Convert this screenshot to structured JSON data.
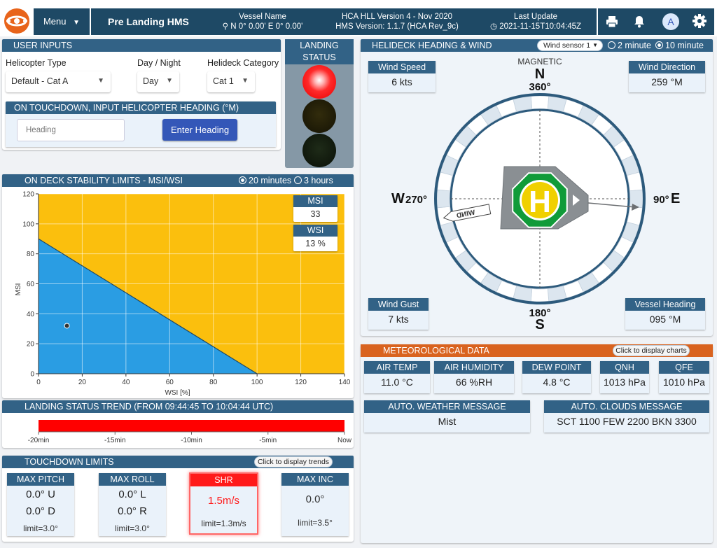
{
  "header": {
    "menu_label": "Menu",
    "page_title": "Pre Landing HMS",
    "vessel_name_label": "Vessel Name",
    "vessel_position": "N 0° 0.00'  E 0° 0.00'",
    "version_line1": "HCA HLL Version 4 - Nov 2020",
    "version_line2": "HMS Version: 1.1.7 (HCA Rev_9c)",
    "last_update_label": "Last Update",
    "last_update_value": "2021-11-15T10:04:45Z",
    "avatar_letter": "A"
  },
  "user_inputs": {
    "title": "USER INPUTS",
    "helicopter_type_label": "Helicopter Type",
    "helicopter_type_value": "Default - Cat A",
    "day_night_label": "Day / Night",
    "day_night_value": "Day",
    "helideck_category_label": "Helideck Category",
    "helideck_category_value": "Cat 1",
    "touchdown_title": "ON TOUCHDOWN, INPUT HELICOPTER HEADING (°M)",
    "heading_placeholder": "Heading",
    "enter_heading_label": "Enter Heading"
  },
  "landing_status": {
    "title_line1": "LANDING",
    "title_line2": "STATUS",
    "state": "red"
  },
  "stability": {
    "title": "ON DECK STABILITY LIMITS - MSI/WSI",
    "option_20min": "20 minutes",
    "option_3h": "3 hours",
    "selected": "20 minutes",
    "msi_label": "MSI",
    "msi_value": "33",
    "wsi_label": "WSI",
    "wsi_value": "13 %"
  },
  "chart_data": {
    "type": "area",
    "xlabel": "WSI [%]",
    "ylabel": "MSI",
    "xlim": [
      0,
      140
    ],
    "ylim": [
      0,
      120
    ],
    "x_ticks": [
      0,
      20,
      40,
      60,
      80,
      100,
      120,
      140
    ],
    "y_ticks": [
      0,
      20,
      40,
      60,
      80,
      100,
      120
    ],
    "limit_line": {
      "x": [
        0,
        100
      ],
      "y": [
        90,
        0
      ]
    },
    "region_below_color": "#2a9de3",
    "region_above_color": "#fbbf0d",
    "current_point": {
      "x": 13,
      "y": 32
    },
    "grid": true
  },
  "trend": {
    "title": "LANDING STATUS TREND (FROM 09:44:45 TO 10:04:44 UTC)",
    "tick_labels": [
      "-20min",
      "-15min",
      "-10min",
      "-5min",
      "Now"
    ],
    "bar_color": "#ff0000"
  },
  "touchdown_limits": {
    "title": "TOUCHDOWN LIMITS",
    "trends_button": "Click to display trends",
    "max_pitch": {
      "label": "MAX PITCH",
      "line1": "0.0° U",
      "line2": "0.0° D",
      "limit": "limit=3.0°"
    },
    "max_roll": {
      "label": "MAX ROLL",
      "line1": "0.0° L",
      "line2": "0.0° R",
      "limit": "limit=3.0°"
    },
    "shr": {
      "label": "SHR",
      "value": "1.5m/s",
      "limit": "limit=1.3m/s"
    },
    "max_inc": {
      "label": "MAX INC",
      "value": "0.0°",
      "limit": "limit=3.5°"
    }
  },
  "helideck": {
    "title": "HELIDECK HEADING & WIND",
    "sensor_value": "Wind sensor 1",
    "option_2min": "2 minute",
    "option_10min": "10 minute",
    "selected": "10 minute",
    "magnetic_label": "MAGNETIC",
    "n_letter": "N",
    "n_deg": "360°",
    "s_letter": "S",
    "s_deg": "180°",
    "w_letter": "W",
    "w_deg": "270°",
    "e_letter": "E",
    "e_deg": "90°",
    "wind_arrow_label": "WIND",
    "helipad_letter": "H",
    "wind_speed": {
      "label": "Wind Speed",
      "value": "6 kts"
    },
    "wind_direction": {
      "label": "Wind Direction",
      "value": "259 °M"
    },
    "wind_gust": {
      "label": "Wind Gust",
      "value": "7 kts"
    },
    "vessel_heading": {
      "label": "Vessel Heading",
      "value": "095 °M"
    }
  },
  "meteo": {
    "title": "METEOROLOGICAL DATA",
    "charts_button": "Click to display charts",
    "air_temp": {
      "label": "AIR TEMP",
      "value": "11.0 °C"
    },
    "air_humidity": {
      "label": "AIR HUMIDITY",
      "value": "66 %RH"
    },
    "dew_point": {
      "label": "DEW POINT",
      "value": "4.8 °C"
    },
    "qnh": {
      "label": "QNH",
      "value": "1013 hPa"
    },
    "qfe": {
      "label": "QFE",
      "value": "1010 hPa"
    },
    "auto_weather": {
      "label": "AUTO. WEATHER MESSAGE",
      "value": "Mist"
    },
    "auto_clouds": {
      "label": "AUTO. CLOUDS MESSAGE",
      "value": "SCT 1100 FEW 2200 BKN 3300"
    }
  }
}
